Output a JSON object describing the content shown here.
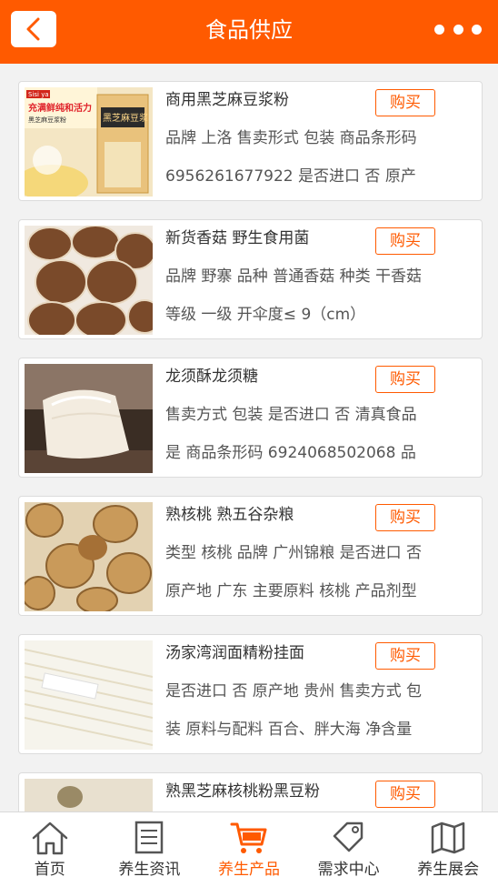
{
  "header": {
    "title": "食品供应",
    "back_icon": "chevron-left-icon",
    "more_icon": "more-dots-icon"
  },
  "products": [
    {
      "name": "商用黑芝麻豆浆粉",
      "buy_label": "购买",
      "line1": "品牌 上洛 售卖形式 包装 商品条形码",
      "line2": "6956261677922 是否进口 否 原产",
      "image_text": {
        "brand": "Sisi ya",
        "slogan": "充满鲜纯和活力",
        "sub": "黑芝麻豆浆粉",
        "pack": "黑芝麻豆浆"
      }
    },
    {
      "name": "新货香菇 野生食用菌",
      "buy_label": "购买",
      "line1": "品牌 野寨 品种 普通香菇 种类 干香菇",
      "line2": "等级 一级 开伞度≤ 9（cm）"
    },
    {
      "name": "龙须酥龙须糖",
      "buy_label": "购买",
      "line1": "售卖方式 包装 是否进口 否 清真食品",
      "line2": "是 商品条形码 6924068502068 品"
    },
    {
      "name": "熟核桃 熟五谷杂粮",
      "buy_label": "购买",
      "line1": "类型 核桃 品牌 广州锦粮 是否进口 否",
      "line2": "原产地 广东 主要原料 核桃 产品剂型"
    },
    {
      "name": "汤家湾润面精粉挂面",
      "buy_label": "购买",
      "line1": "是否进口 否 原产地 贵州 售卖方式 包",
      "line2": "装 原料与配料 百合、胖大海 净含量"
    },
    {
      "name": "熟黑芝麻核桃粉黑豆粉",
      "buy_label": "购买",
      "line1": "",
      "line2": ""
    }
  ],
  "tabbar": [
    {
      "label": "首页",
      "icon": "home-icon",
      "active": false
    },
    {
      "label": "养生资讯",
      "icon": "news-icon",
      "active": false
    },
    {
      "label": "养生产品",
      "icon": "cart-icon",
      "active": true
    },
    {
      "label": "需求中心",
      "icon": "tag-icon",
      "active": false
    },
    {
      "label": "养生展会",
      "icon": "map-icon",
      "active": false
    }
  ],
  "colors": {
    "accent": "#ff5a00",
    "background": "#f2f2f2",
    "text": "#333333"
  }
}
